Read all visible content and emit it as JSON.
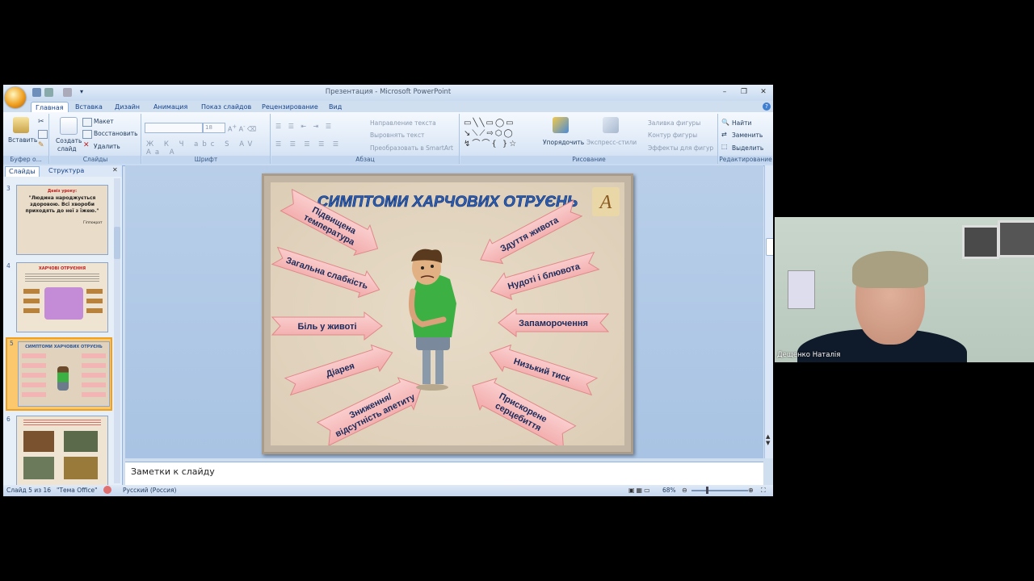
{
  "window": {
    "title": "Презентация - Microsoft PowerPoint"
  },
  "tabs": [
    {
      "label": "Главная",
      "active": true
    },
    {
      "label": "Вставка"
    },
    {
      "label": "Дизайн"
    },
    {
      "label": "Анимация"
    },
    {
      "label": "Показ слайдов"
    },
    {
      "label": "Рецензирование"
    },
    {
      "label": "Вид"
    }
  ],
  "ribbon": {
    "clipboard": {
      "label": "Буфер о...",
      "paste": "Вставить"
    },
    "slides": {
      "label": "Слайды",
      "create": "Создать",
      "create2": "слайд",
      "layout": "Макет",
      "reset": "Восстановить",
      "delete": "Удалить"
    },
    "font": {
      "label": "Шрифт",
      "size": "18"
    },
    "paragraph": {
      "label": "Абзац",
      "text_direction": "Направление текста",
      "align_text": "Выровнять текст",
      "smartart": "Преобразовать в SmartArt"
    },
    "drawing": {
      "label": "Рисование",
      "arrange": "Упорядочить",
      "quick_styles": "Экспресс-стили",
      "fill": "Заливка фигуры",
      "outline": "Контур фигуры",
      "effects": "Эффекты для фигур"
    },
    "editing": {
      "label": "Редактирование",
      "find": "Найти",
      "replace": "Заменить",
      "select": "Выделить"
    }
  },
  "pane": {
    "tab_slides": "Слайды",
    "tab_outline": "Структура",
    "thumbs": [
      {
        "num": "3",
        "title": "Девіз уроку:",
        "quote": "\"Людина народжується здоровою. Всі хвороби приходять до неї з їжею.\"",
        "author": "Гіппократ"
      },
      {
        "num": "4",
        "title": "ХАРЧОВІ ОТРУЄННЯ"
      },
      {
        "num": "5",
        "title": "СИМПТОМИ ХАРЧОВИХ ОТРУЄНЬ"
      },
      {
        "num": "6"
      }
    ]
  },
  "slide": {
    "title": "СИМПТОМИ ХАРЧОВИХ ОТРУЄНЬ",
    "left": [
      "Підвищена температура",
      "Загальна слабкість",
      "Біль у животі",
      "Діарея",
      "Зниження/ відсутність апетиту"
    ],
    "right": [
      "Здуття живота",
      "Нудоті і блювота",
      "Запаморочення",
      "Низький тиск",
      "Прискорене серцебиття"
    ]
  },
  "notes": {
    "placeholder": "Заметки к слайду"
  },
  "status": {
    "slide": "Слайд 5 из 16",
    "theme": "\"Тема Office\"",
    "lang": "Русский (Россия)",
    "zoom": "68%"
  },
  "webcam": {
    "name": "Дещенко Наталія"
  }
}
